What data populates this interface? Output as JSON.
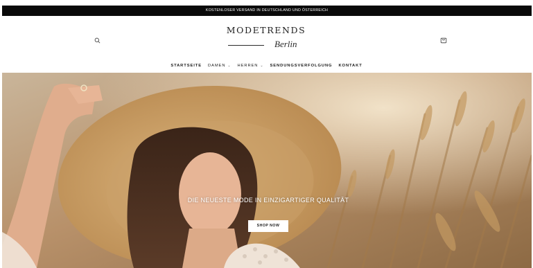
{
  "announcement": {
    "text": "KOSTENLOSER VERSAND IN DEUTSCHLAND UND ÖSTERREICH"
  },
  "header": {
    "logo_title": "MODETRENDS",
    "logo_script": "Berlin",
    "search_icon": "search-icon",
    "cart_icon": "shopping-bag-icon"
  },
  "nav": {
    "items": [
      {
        "label": "STARTSEITE",
        "dropdown": false
      },
      {
        "label": "DAMEN",
        "dropdown": true
      },
      {
        "label": "HERREN",
        "dropdown": true
      },
      {
        "label": "SENDUNGSVERFOLGUNG",
        "dropdown": false
      },
      {
        "label": "KONTAKT",
        "dropdown": false
      }
    ],
    "chevron_icon": "chevron-down-icon"
  },
  "hero": {
    "heading": "DIE NEUESTE MODE IN EINZIGARTIGER QUALITÄT",
    "button_label": "SHOP NOW"
  },
  "colors": {
    "announcement_bg": "#0a0a0a",
    "text": "#1a1a1a",
    "background": "#ffffff"
  }
}
